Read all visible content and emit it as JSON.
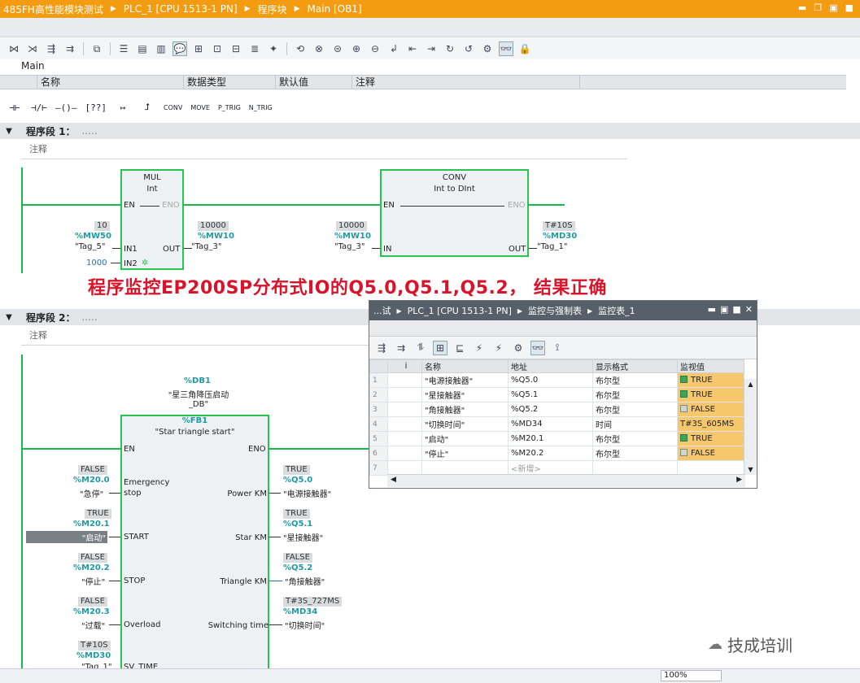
{
  "title_bar": {
    "crumbs": [
      "485FH高性能模块测试",
      "PLC_1 [CPU 1513-1 PN]",
      "程序块",
      "Main [OB1]"
    ]
  },
  "interface": {
    "title": "Main",
    "columns": [
      "名称",
      "数据类型",
      "默认值",
      "注释"
    ]
  },
  "lad_palette": [
    "CONV",
    "MOVE",
    "P_TRIG",
    "N_TRIG"
  ],
  "networks": [
    {
      "label": "程序段 1：",
      "dots": ".....",
      "comment": "注释"
    },
    {
      "label": "程序段 2：",
      "dots": ".....",
      "comment": "注释"
    }
  ],
  "net1": {
    "mul": {
      "name": "MUL",
      "type": "Int",
      "en": "EN",
      "eno": "ENO",
      "in1": "IN1",
      "in2": "IN2",
      "out": "OUT",
      "in1_val": "10",
      "in1_addr": "%MW50",
      "in1_tag": "\"Tag_5\"",
      "in2_const": "1000",
      "out_val": "10000",
      "out_addr": "%MW10",
      "out_tag": "\"Tag_3\""
    },
    "conv": {
      "name": "CONV",
      "type": "Int  to  DInt",
      "en": "EN",
      "eno": "ENO",
      "in": "IN",
      "out": "OUT",
      "in_val": "10000",
      "in_addr": "%MW10",
      "in_tag": "\"Tag_3\"",
      "out_val": "T#10S",
      "out_addr": "%MD30",
      "out_tag": "\"Tag_1\""
    }
  },
  "caption": "程序监控EP200SP分布式IO的Q5.0,Q5.1,Q5.2， 结果正确",
  "net2": {
    "db_addr": "%DB1",
    "db_name": "\"星三角降压启动_DB\"",
    "fb_addr": "%FB1",
    "fb_name": "\"Star triangle start\"",
    "en": "EN",
    "eno": "ENO",
    "inputs": [
      {
        "pin": "Emergency stop",
        "val": "FALSE",
        "addr": "%M20.0",
        "tag": "\"急停\""
      },
      {
        "pin": "START",
        "val": "TRUE",
        "addr": "%M20.1",
        "tag": "\"启动\""
      },
      {
        "pin": "STOP",
        "val": "FALSE",
        "addr": "%M20.2",
        "tag": "\"停止\""
      },
      {
        "pin": "Overload",
        "val": "FALSE",
        "addr": "%M20.3",
        "tag": "\"过载\""
      },
      {
        "pin": "SV_TIME",
        "val": "T#10S",
        "addr": "%MD30",
        "tag": "\"Tag_1\""
      }
    ],
    "outputs": [
      {
        "pin": "Power KM",
        "val": "TRUE",
        "addr": "%Q5.0",
        "tag": "\"电源接触器\""
      },
      {
        "pin": "Star  KM",
        "val": "TRUE",
        "addr": "%Q5.1",
        "tag": "\"星接触器\""
      },
      {
        "pin": "Triangle KM",
        "val": "FALSE",
        "addr": "%Q5.2",
        "tag": "\"角接触器\""
      },
      {
        "pin": "Switching time",
        "val": "T#3S_727MS",
        "addr": "%MD34",
        "tag": "\"切换时间\""
      }
    ]
  },
  "watch": {
    "crumbs": [
      "...试",
      "PLC_1 [CPU 1513-1 PN]",
      "监控与强制表",
      "监控表_1"
    ],
    "columns": [
      "i",
      "名称",
      "地址",
      "显示格式",
      "监视值"
    ],
    "rows": [
      {
        "idx": "1",
        "name": "\"电源接触器\"",
        "addr": "%Q5.0",
        "fmt": "布尔型",
        "mon": "TRUE",
        "on": true
      },
      {
        "idx": "2",
        "name": "\"星接触器\"",
        "addr": "%Q5.1",
        "fmt": "布尔型",
        "mon": "TRUE",
        "on": true
      },
      {
        "idx": "3",
        "name": "\"角接触器\"",
        "addr": "%Q5.2",
        "fmt": "布尔型",
        "mon": "FALSE",
        "on": false
      },
      {
        "idx": "4",
        "name": "\"切换时间\"",
        "addr": "%MD34",
        "fmt": "时间",
        "mon": "T#3S_605MS",
        "on": null
      },
      {
        "idx": "5",
        "name": "\"启动\"",
        "addr": "%M20.1",
        "fmt": "布尔型",
        "mon": "TRUE",
        "on": true
      },
      {
        "idx": "6",
        "name": "\"停止\"",
        "addr": "%M20.2",
        "fmt": "布尔型",
        "mon": "FALSE",
        "on": false
      },
      {
        "idx": "7",
        "name": "",
        "addr": "<新增>",
        "fmt": "",
        "mon": "",
        "on": null
      }
    ]
  },
  "status": {
    "zoom": "100%"
  },
  "watermark": "技成培训",
  "colors": {
    "accent": "#f39c12",
    "rail": "#19b84f",
    "address": "#1f9aa3",
    "caption": "#d9142a",
    "monitor": "#f6c76d"
  }
}
